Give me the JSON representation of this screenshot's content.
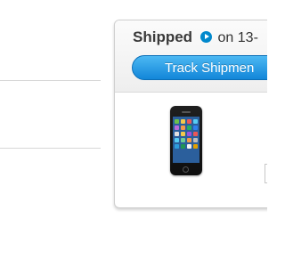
{
  "order": {
    "status_label": "Shipped",
    "status_date": "on 13-",
    "track_button_label": "Track Shipmen",
    "item_text": "i"
  },
  "icons": {
    "status_arrow": "play-circle-icon",
    "product": "iphone-product-image"
  },
  "colors": {
    "accent": "#0088cc",
    "button_top": "#4cb8f3",
    "button_bottom": "#1286d9",
    "card_border": "#cfcfcf"
  }
}
